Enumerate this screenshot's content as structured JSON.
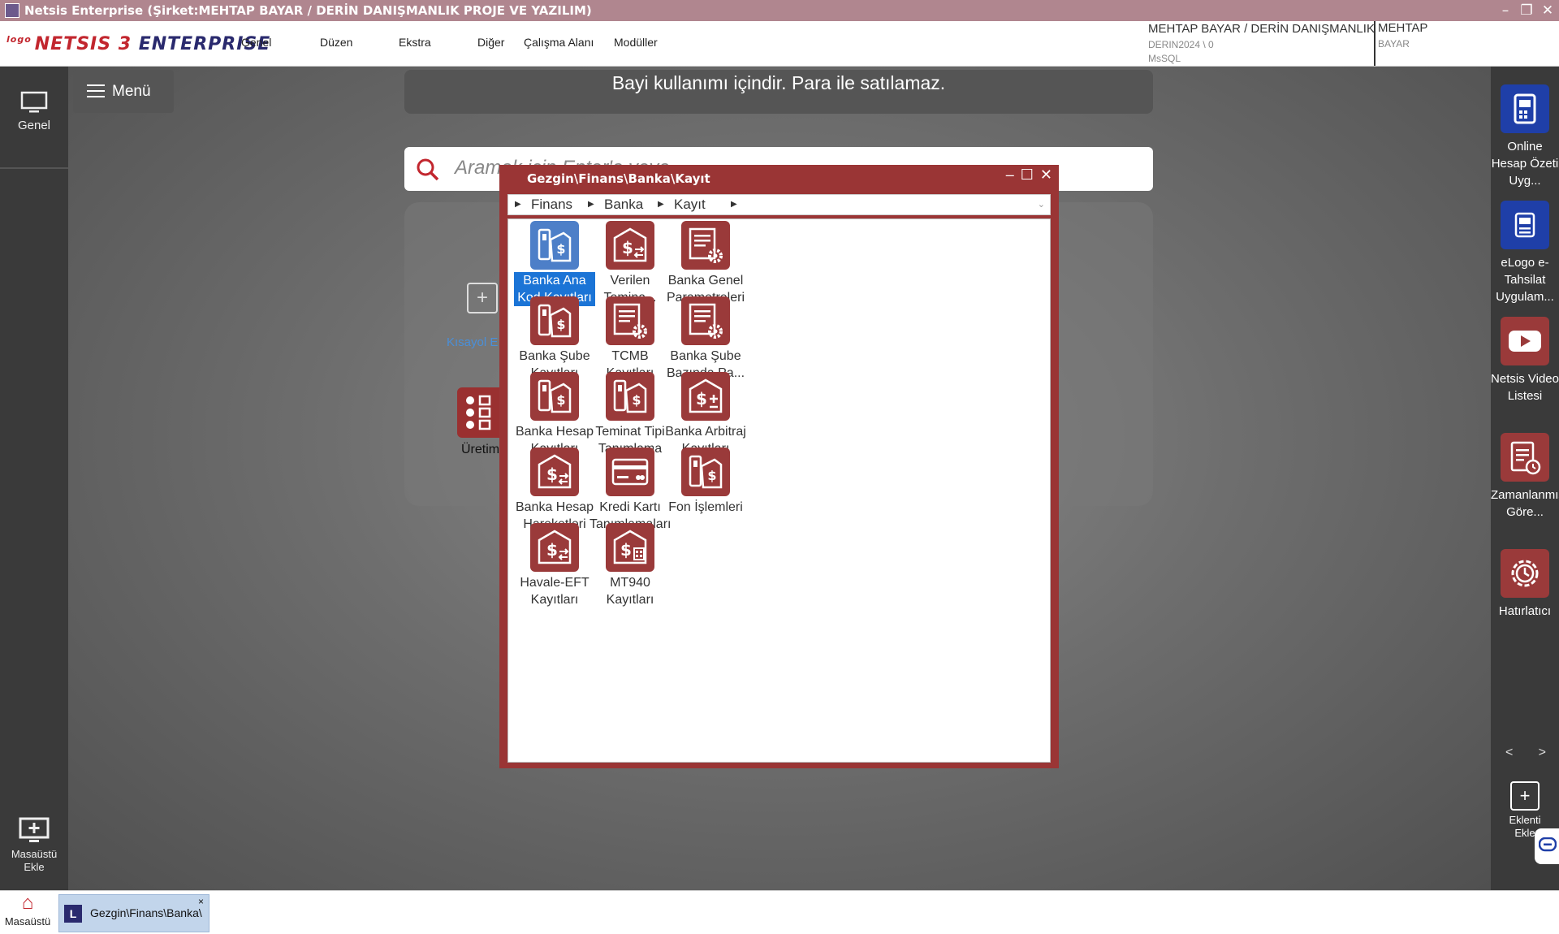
{
  "window": {
    "title": "Netsis Enterprise (Şirket:MEHTAP BAYAR / DERİN DANIŞMANLIK PROJE VE YAZILIM)"
  },
  "logo": {
    "prefix": "logo",
    "name": "NETSIS 3",
    "suffix": "ENTERPRISE"
  },
  "menu": [
    {
      "label": "Genel"
    },
    {
      "label": "Düzen"
    },
    {
      "label": "Ekstra"
    },
    {
      "label": "Diğer"
    },
    {
      "label": "Çalışma Alanı"
    },
    {
      "label": "Modüller"
    }
  ],
  "user": {
    "company": "MEHTAP BAYAR / DERİN DANIŞMANLIK",
    "db": "DERIN2024 \\ 0",
    "server": "MsSQL",
    "first": "MEHTAP",
    "last": "BAYAR"
  },
  "left_sidebar": {
    "genel": "Genel",
    "add_desktop": "Masaüstü Ekle"
  },
  "desktop": {
    "menu_label": "Menü",
    "banner": "Bayi kullanımı içindir. Para ile satılamaz.",
    "search_placeholder": "Aramak için Enter'a veya",
    "shortcut_label": "Kısayol E",
    "production_label": "Üretim"
  },
  "dialog": {
    "title": "Gezgin\\Finans\\Banka\\Kayıt",
    "breadcrumb": [
      "Finans",
      "Banka",
      "Kayıt"
    ],
    "items": [
      {
        "label": "Banka Ana Kod Kayıtları",
        "icon": "bank-ledger-icon",
        "selected": true
      },
      {
        "label": "Verilen Temina...",
        "icon": "exchange-money-icon",
        "selected": false
      },
      {
        "label": "Banka Genel Parametreleri",
        "icon": "settings-doc-icon",
        "selected": false
      },
      {
        "label": "Banka Şube Kayıtları",
        "icon": "bank-ledger-icon",
        "selected": false
      },
      {
        "label": "TCMB Kayıtları",
        "icon": "settings-doc-icon",
        "selected": false
      },
      {
        "label": "Banka Şube Bazında Pa...",
        "icon": "settings-doc-icon",
        "selected": false
      },
      {
        "label": "Banka Hesap Kayıtları",
        "icon": "bank-ledger-icon",
        "selected": false
      },
      {
        "label": "Teminat Tipi Tanımlama",
        "icon": "bank-ledger-icon",
        "selected": false
      },
      {
        "label": "Banka Arbitraj Kayıtları",
        "icon": "arbitrage-icon",
        "selected": false
      },
      {
        "label": "Banka Hesap Hareketleri",
        "icon": "exchange-money-icon",
        "selected": false
      },
      {
        "label": "Kredi Kartı Tanımlamaları",
        "icon": "credit-card-icon",
        "selected": false
      },
      {
        "label": "Fon İşlemleri",
        "icon": "bank-ledger-icon",
        "selected": false
      },
      {
        "label": "Havale-EFT Kayıtları",
        "icon": "exchange-money-icon",
        "selected": false
      },
      {
        "label": "MT940 Kayıtları",
        "icon": "calculator-money-icon",
        "selected": false
      }
    ]
  },
  "right_sidebar": [
    {
      "label": "Online Hesap Özeti Uyg...",
      "icon": "document-icon",
      "color": "#1f3fa8"
    },
    {
      "label": "eLogo e-Tahsilat Uygulam...",
      "icon": "pos-terminal-icon",
      "color": "#1f3fa8"
    },
    {
      "label": "Netsis Video Listesi",
      "icon": "video-play-icon",
      "color": "#9a3a3a"
    },
    {
      "label": "Zamanlanmış Göre...",
      "icon": "scheduled-task-icon",
      "color": "#9a3a3a"
    },
    {
      "label": "Hatırlatıcı",
      "icon": "gear-clock-icon",
      "color": "#9a3a3a"
    }
  ],
  "right_nav": {
    "prev": "<",
    "next": ">",
    "add_plugin": "Eklenti Ekle"
  },
  "taskbar": {
    "home": "Masaüstü",
    "task": "Gezgin\\Finans\\Banka\\"
  },
  "colors": {
    "accent_red": "#9a3535",
    "accent_blue": "#1f3fa8",
    "selection": "#1b74d6"
  }
}
